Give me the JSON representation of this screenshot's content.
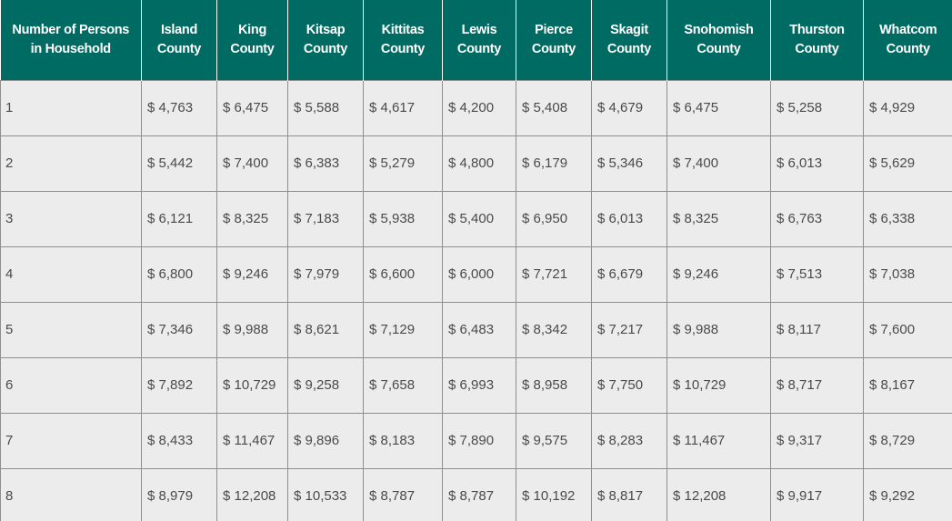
{
  "header_color": "#006b63",
  "columns": [
    {
      "line1": "Number of Persons",
      "line2": "in Household"
    },
    {
      "line1": "Island",
      "line2": "County"
    },
    {
      "line1": "King",
      "line2": "County"
    },
    {
      "line1": "Kitsap",
      "line2": "County"
    },
    {
      "line1": "Kittitas",
      "line2": "County"
    },
    {
      "line1": "Lewis",
      "line2": "County"
    },
    {
      "line1": "Pierce",
      "line2": "County"
    },
    {
      "line1": "Skagit",
      "line2": "County"
    },
    {
      "line1": "Snohomish",
      "line2": "County"
    },
    {
      "line1": "Thurston",
      "line2": "County"
    },
    {
      "line1": "Whatcom",
      "line2": "County"
    }
  ],
  "rows": [
    [
      "1",
      "$ 4,763",
      "$ 6,475",
      "$ 5,588",
      "$ 4,617",
      "$ 4,200",
      "$ 5,408",
      "$ 4,679",
      "$ 6,475",
      "$ 5,258",
      "$ 4,929"
    ],
    [
      "2",
      "$ 5,442",
      "$ 7,400",
      "$ 6,383",
      "$ 5,279",
      "$ 4,800",
      "$ 6,179",
      "$ 5,346",
      "$ 7,400",
      "$ 6,013",
      "$ 5,629"
    ],
    [
      "3",
      "$ 6,121",
      "$ 8,325",
      "$ 7,183",
      "$ 5,938",
      "$ 5,400",
      "$ 6,950",
      "$ 6,013",
      "$ 8,325",
      "$ 6,763",
      "$ 6,338"
    ],
    [
      "4",
      "$ 6,800",
      "$ 9,246",
      "$ 7,979",
      "$ 6,600",
      "$ 6,000",
      "$ 7,721",
      "$ 6,679",
      "$ 9,246",
      "$ 7,513",
      "$ 7,038"
    ],
    [
      "5",
      "$ 7,346",
      "$ 9,988",
      "$ 8,621",
      "$ 7,129",
      "$ 6,483",
      "$ 8,342",
      "$ 7,217",
      "$ 9,988",
      "$ 8,117",
      "$ 7,600"
    ],
    [
      "6",
      "$ 7,892",
      "$ 10,729",
      "$ 9,258",
      "$ 7,658",
      "$ 6,993",
      "$ 8,958",
      "$ 7,750",
      "$ 10,729",
      "$ 8,717",
      "$ 8,167"
    ],
    [
      "7",
      "$ 8,433",
      "$ 11,467",
      "$ 9,896",
      "$ 8,183",
      "$ 7,890",
      "$ 9,575",
      "$ 8,283",
      "$ 11,467",
      "$ 9,317",
      "$ 8,729"
    ],
    [
      "8",
      "$ 8,979",
      "$ 12,208",
      "$ 10,533",
      "$ 8,787",
      "$ 8,787",
      "$ 10,192",
      "$ 8,817",
      "$ 12,208",
      "$ 9,917",
      "$ 9,292"
    ]
  ]
}
